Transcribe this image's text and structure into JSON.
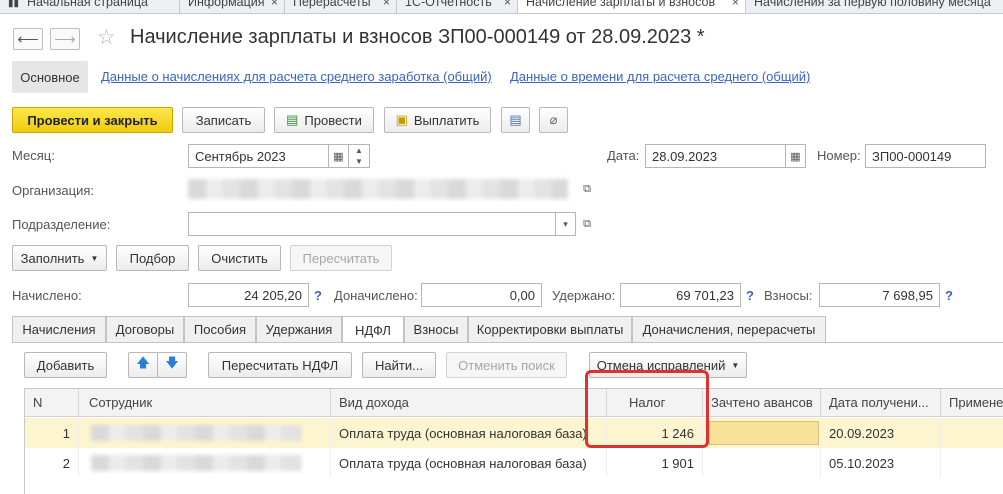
{
  "window_tabs": [
    {
      "label": "Начальная страница",
      "active": false
    },
    {
      "label": "Информация",
      "active": false
    },
    {
      "label": "Перерасчеты",
      "active": false
    },
    {
      "label": "1С-Отчетность",
      "active": false
    },
    {
      "label": "Начисление зарплаты и взносов",
      "active": true
    },
    {
      "label": "Начисления за первую половину месяца",
      "active": false
    }
  ],
  "header": {
    "title": "Начисление зарплаты и взносов ЗП00-000149 от 28.09.2023 *"
  },
  "section_tabs": {
    "main": "Основное",
    "link1": "Данные о начислениях для расчета среднего заработка (общий)",
    "link2": "Данные о времени для расчета среднего (общий)"
  },
  "toolbar": {
    "post_close": "Провести и закрыть",
    "save": "Записать",
    "post": "Провести",
    "pay": "Выплатить"
  },
  "form": {
    "month_label": "Месяц:",
    "month_value": "Сентябрь 2023",
    "date_label": "Дата:",
    "date_value": "28.09.2023",
    "number_label": "Номер:",
    "number_value": "ЗП00-000149",
    "org_label": "Организация:",
    "dept_label": "Подразделение:"
  },
  "actions": {
    "fill": "Заполнить",
    "select": "Подбор",
    "clear": "Очистить",
    "recalc": "Пересчитать"
  },
  "totals": {
    "accrued_label": "Начислено:",
    "accrued_value": "24 205,20",
    "additional_label": "Доначислено:",
    "additional_value": "0,00",
    "withheld_label": "Удержано:",
    "withheld_value": "69 701,23",
    "contrib_label": "Взносы:",
    "contrib_value": "7 698,95",
    "help": "?"
  },
  "inner_tabs": [
    "Начисления",
    "Договоры",
    "Пособия",
    "Удержания",
    "НДФЛ",
    "Взносы",
    "Корректировки выплаты",
    "Доначисления, перерасчеты"
  ],
  "inner_active": "НДФЛ",
  "grid_toolbar": {
    "add": "Добавить",
    "recalc_ndfl": "Пересчитать НДФЛ",
    "find": "Найти...",
    "cancel_search": "Отменить поиск",
    "cancel_fix": "Отмена исправлений"
  },
  "table": {
    "columns": [
      "N",
      "Сотрудник",
      "Вид дохода",
      "Налог",
      "Зачтено авансов",
      "Дата получени...",
      "Применен"
    ],
    "rows": [
      {
        "n": "1",
        "income": "Оплата труда (основная налоговая база)",
        "tax": "1 246",
        "advance": "",
        "date": "20.09.2023",
        "selected": true
      },
      {
        "n": "2",
        "income": "Оплата труда (основная налоговая база)",
        "tax": "1 901",
        "advance": "",
        "date": "05.10.2023",
        "selected": false
      }
    ]
  },
  "colors": {
    "accent_yellow": "#f5d21c",
    "link_blue": "#3b63c4",
    "highlight_red": "#e03030",
    "selected_row": "#fdf5cf"
  }
}
